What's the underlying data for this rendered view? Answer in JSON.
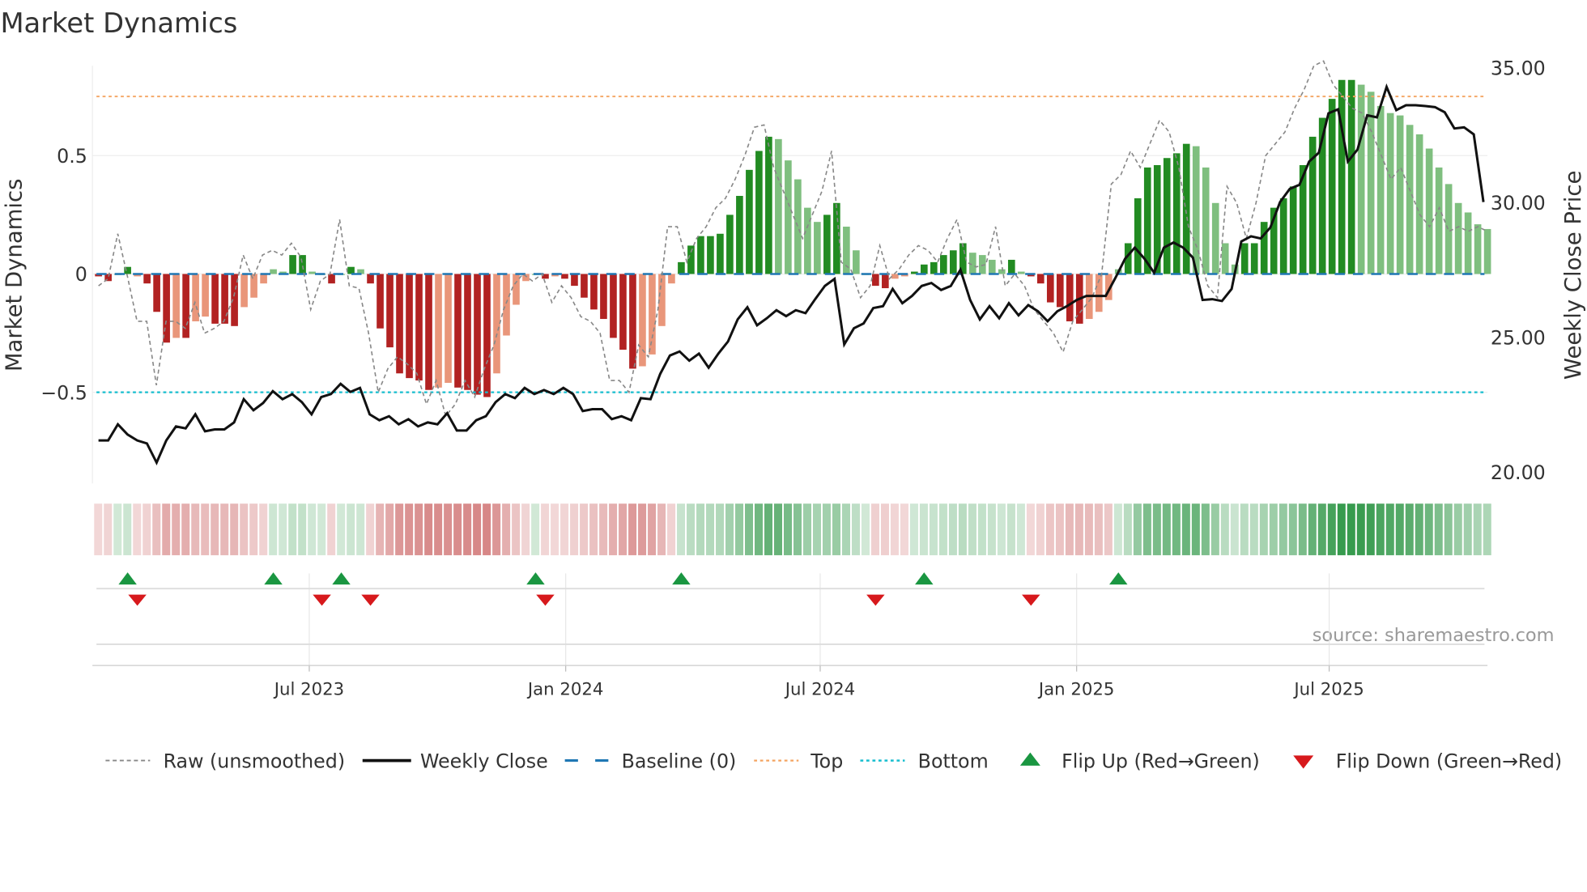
{
  "chart_data": {
    "type": "bar",
    "title": "Market Dynamics",
    "ylabel": "Market Dynamics",
    "y2label": "Weekly Close Price",
    "ylim": [
      -0.885,
      0.88
    ],
    "y2lim": [
      19.6,
      35.1
    ],
    "yticks": [
      {
        "v": 0.5,
        "label": "0.5"
      },
      {
        "v": 0,
        "label": "0"
      },
      {
        "v": -0.5,
        "label": "−0.5"
      }
    ],
    "y2ticks": [
      {
        "v": 35,
        "label": "35.00"
      },
      {
        "v": 30,
        "label": "30.00"
      },
      {
        "v": 25,
        "label": "25.00"
      },
      {
        "v": 20,
        "label": "20.00"
      }
    ],
    "xticks": [
      {
        "week": 21.7,
        "label": "Jul 2023"
      },
      {
        "week": 48.1,
        "label": "Jan 2024"
      },
      {
        "week": 74.3,
        "label": "Jul 2024"
      },
      {
        "week": 100.7,
        "label": "Jan 2025"
      },
      {
        "week": 126.7,
        "label": "Jul 2025"
      }
    ],
    "top_level": 0.75,
    "bottom_level": -0.5,
    "baseline": 0,
    "smoothed": [
      -0.01,
      -0.03,
      0.0,
      0.03,
      -0.01,
      -0.04,
      -0.16,
      -0.29,
      -0.27,
      -0.27,
      -0.2,
      -0.18,
      -0.21,
      -0.21,
      -0.22,
      -0.14,
      -0.1,
      -0.04,
      0.02,
      0.01,
      0.08,
      0.08,
      0.01,
      0.0,
      -0.04,
      0.0,
      0.03,
      0.02,
      -0.04,
      -0.23,
      -0.31,
      -0.42,
      -0.44,
      -0.45,
      -0.49,
      -0.48,
      -0.46,
      -0.48,
      -0.49,
      -0.51,
      -0.52,
      -0.42,
      -0.26,
      -0.13,
      -0.03,
      0.0,
      -0.02,
      -0.01,
      -0.02,
      -0.05,
      -0.1,
      -0.15,
      -0.19,
      -0.27,
      -0.32,
      -0.4,
      -0.39,
      -0.34,
      -0.22,
      -0.04,
      0.05,
      0.12,
      0.16,
      0.16,
      0.17,
      0.25,
      0.33,
      0.44,
      0.52,
      0.58,
      0.57,
      0.48,
      0.4,
      0.28,
      0.22,
      0.25,
      0.3,
      0.2,
      0.1,
      0.0,
      -0.05,
      -0.06,
      -0.02,
      -0.01,
      0.01,
      0.04,
      0.05,
      0.08,
      0.1,
      0.13,
      0.09,
      0.08,
      0.06,
      0.02,
      0.06,
      0.01,
      -0.01,
      -0.04,
      -0.12,
      -0.14,
      -0.2,
      -0.21,
      -0.19,
      -0.16,
      -0.11,
      0.02,
      0.13,
      0.32,
      0.45,
      0.46,
      0.49,
      0.51,
      0.55,
      0.54,
      0.45,
      0.3,
      0.13,
      0.04,
      0.13,
      0.13,
      0.22,
      0.28,
      0.32,
      0.37,
      0.46,
      0.58,
      0.66,
      0.74,
      0.82,
      0.82,
      0.8,
      0.77,
      0.71,
      0.68,
      0.67,
      0.63,
      0.59,
      0.53,
      0.45,
      0.38,
      0.3,
      0.26,
      0.21,
      0.19
    ],
    "raw": [
      -0.05,
      -0.02,
      0.17,
      -0.01,
      -0.2,
      -0.2,
      -0.47,
      -0.2,
      -0.2,
      -0.23,
      -0.12,
      -0.25,
      -0.23,
      -0.2,
      -0.1,
      0.08,
      -0.02,
      0.08,
      0.1,
      0.08,
      0.13,
      0.07,
      -0.15,
      -0.03,
      0.0,
      0.23,
      -0.05,
      -0.06,
      -0.25,
      -0.5,
      -0.4,
      -0.35,
      -0.38,
      -0.42,
      -0.55,
      -0.45,
      -0.6,
      -0.55,
      -0.45,
      -0.52,
      -0.4,
      -0.3,
      -0.15,
      -0.05,
      0.0,
      -0.03,
      0.0,
      -0.12,
      -0.05,
      -0.1,
      -0.18,
      -0.2,
      -0.25,
      -0.45,
      -0.45,
      -0.5,
      -0.3,
      -0.35,
      -0.15,
      0.2,
      0.2,
      0.05,
      0.15,
      0.2,
      0.28,
      0.32,
      0.4,
      0.5,
      0.62,
      0.63,
      0.45,
      0.35,
      0.25,
      0.15,
      0.25,
      0.35,
      0.52,
      0.05,
      0.02,
      -0.1,
      -0.05,
      0.12,
      -0.02,
      0.02,
      0.08,
      0.12,
      0.1,
      0.05,
      0.15,
      0.23,
      0.05,
      0.03,
      0.04,
      0.2,
      -0.05,
      0.0,
      -0.05,
      -0.15,
      -0.2,
      -0.25,
      -0.33,
      -0.2,
      -0.15,
      -0.1,
      0.0,
      0.38,
      0.42,
      0.52,
      0.45,
      0.55,
      0.65,
      0.6,
      0.45,
      0.2,
      0.1,
      -0.05,
      -0.1,
      0.37,
      0.3,
      0.15,
      0.3,
      0.5,
      0.55,
      0.6,
      0.7,
      0.78,
      0.88,
      0.9,
      0.8,
      0.75,
      0.7,
      0.68,
      0.6,
      0.5,
      0.4,
      0.45,
      0.35,
      0.25,
      0.2,
      0.28,
      0.18,
      0.2,
      0.18,
      0.2,
      0.18
    ],
    "close": [
      21.18,
      21.18,
      21.78,
      21.4,
      21.18,
      21.07,
      20.36,
      21.18,
      21.7,
      21.63,
      22.15,
      21.52,
      21.59,
      21.59,
      21.85,
      22.71,
      22.3,
      22.57,
      23.01,
      22.71,
      22.9,
      22.6,
      22.15,
      22.79,
      22.9,
      23.28,
      22.98,
      23.13,
      22.15,
      21.93,
      22.08,
      21.78,
      21.97,
      21.7,
      21.85,
      21.78,
      22.19,
      21.55,
      21.55,
      21.93,
      22.08,
      22.6,
      22.9,
      22.75,
      23.13,
      22.9,
      23.05,
      22.9,
      23.13,
      22.9,
      22.27,
      22.34,
      22.34,
      21.97,
      22.08,
      21.93,
      22.75,
      22.71,
      23.65,
      24.33,
      24.48,
      24.14,
      24.4,
      23.88,
      24.4,
      24.85,
      25.67,
      26.12,
      25.45,
      25.71,
      26.01,
      25.79,
      26.01,
      25.9,
      26.42,
      26.91,
      27.17,
      24.74,
      25.34,
      25.52,
      26.09,
      26.16,
      26.8,
      26.27,
      26.54,
      26.91,
      27.02,
      26.76,
      26.91,
      27.51,
      26.39,
      25.67,
      26.16,
      25.71,
      26.27,
      25.82,
      26.2,
      25.97,
      25.6,
      25.97,
      26.16,
      26.39,
      26.54,
      26.54,
      26.54,
      27.21,
      27.92,
      28.33,
      27.92,
      27.4,
      28.33,
      28.52,
      28.33,
      27.96,
      26.39,
      26.42,
      26.35,
      26.8,
      28.56,
      28.75,
      28.67,
      29.08,
      30.02,
      30.51,
      30.66,
      31.52,
      31.85,
      33.31,
      33.46,
      31.52,
      31.97,
      33.24,
      33.16,
      34.29,
      33.43,
      33.61,
      33.61,
      33.58,
      33.54,
      33.35,
      32.75,
      32.79,
      32.53,
      30.02
    ],
    "flip_up_weeks": [
      3,
      18,
      25,
      45,
      60,
      85,
      105
    ],
    "flip_down_weeks": [
      4,
      23,
      28,
      46,
      80,
      96
    ],
    "colors": {
      "up_strong": "#228b22",
      "up_weak": "#7fbf7f",
      "down_strong": "#b22222",
      "down_weak": "#e9967a",
      "raw": "#888888",
      "close": "#111111",
      "baseline": "#1f77b4",
      "top": "#f4a460",
      "bottom": "#17becf",
      "flip_up": "#1a9641",
      "flip_down": "#d7191c"
    },
    "legend": {
      "placement": "bottom",
      "items": [
        "Raw (unsmoothed)",
        "Weekly Close",
        "Baseline (0)",
        "Top",
        "Bottom",
        "Flip Up (Red→Green)",
        "Flip Down (Green→Red)"
      ]
    },
    "source": "source: sharemaestro.com"
  }
}
